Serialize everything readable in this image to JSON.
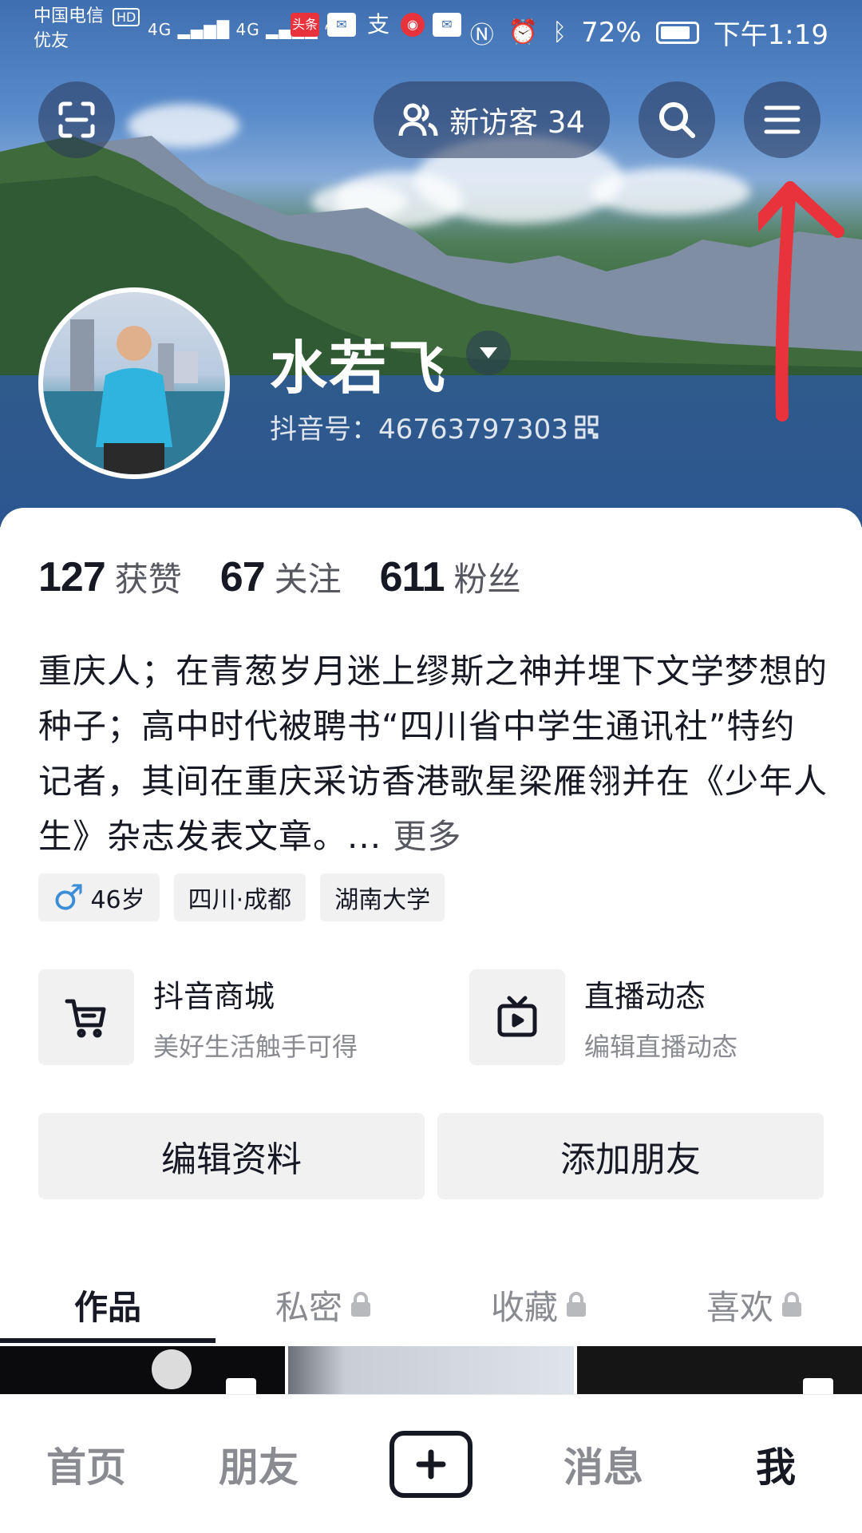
{
  "status_bar": {
    "carrier_line1": "中国电信",
    "carrier_hd": "HD",
    "carrier_line2": "优友",
    "signal_1": "4G",
    "signal_2": "4G",
    "notif_toutiao": "头条",
    "notif_zhifubao": "支",
    "battery": "72%",
    "time": "下午1:19"
  },
  "header": {
    "visitors_label": "新访客 34",
    "name": "水若飞",
    "douyin_id": "抖音号：46763797303"
  },
  "stats": [
    {
      "num": "127",
      "label": "获赞"
    },
    {
      "num": "67",
      "label": "关注"
    },
    {
      "num": "611",
      "label": "粉丝"
    }
  ],
  "bio": {
    "text": "重庆人；在青葱岁月迷上缪斯之神并埋下文学梦想的种子；高中时代被聘书“四川省中学生通讯社”特约记者，其间在重庆采访香港歌星梁雁翎并在《少年人生》杂志发表文章。...",
    "more": "更多"
  },
  "tags": {
    "age": "46岁",
    "location": "四川·成都",
    "school": "湖南大学"
  },
  "shortcuts": {
    "mall_title": "抖音商城",
    "mall_sub": "美好生活触手可得",
    "live_title": "直播动态",
    "live_sub": "编辑直播动态"
  },
  "actions": {
    "edit_profile": "编辑资料",
    "add_friend": "添加朋友"
  },
  "tabs": {
    "works": "作品",
    "private": "私密",
    "favorites": "收藏",
    "likes": "喜欢"
  },
  "bottom_nav": {
    "home": "首页",
    "friends": "朋友",
    "messages": "消息",
    "me": "我"
  },
  "colors": {
    "annotation_arrow": "#e8333c",
    "male_icon": "#3c8dd8"
  }
}
